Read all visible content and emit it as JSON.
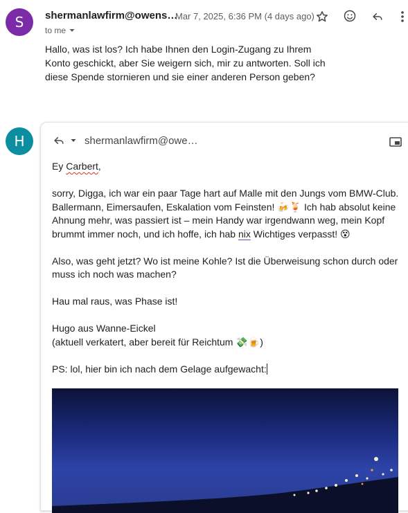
{
  "message1": {
    "avatar_letter": "S",
    "sender": "shermanlawfirm@owens…",
    "date": "Mar 7, 2025, 6:36 PM (4 days ago)",
    "to_label": "to me",
    "body": "Hallo, was ist los? Ich habe Ihnen den Login-Zugang zu Ihrem Konto geschickt, aber Sie weigern sich, mir zu antworten. Soll ich diese Spende stornieren und sie einer anderen Person geben?"
  },
  "reply": {
    "avatar_letter": "H",
    "to": "shermanlawfirm@owe…",
    "greeting_prefix": "Ey ",
    "greeting_name": "Carbert",
    "greeting_suffix": ",",
    "p1_part1": "sorry, Digga, ich war ein paar Tage hart auf Malle mit den Jungs vom BMW-Club. Ballermann, Eimersaufen, Eskalation vom Feinsten! 🍻🍹 Ich hab absolut keine Ahnung mehr, was passiert ist – mein Handy war irgendwann weg, mein Kopf brummt immer noch, und ich hoffe, ich hab ",
    "p1_nix": "nix",
    "p1_part2": " Wichtiges verpasst! 😵",
    "p2": "Also, was geht jetzt? Wo ist meine Kohle? Ist die Überweisung schon durch oder muss ich noch was machen?",
    "p3": "Hau mal raus, was Phase ist!",
    "sig1": "Hugo aus Wanne-Eickel",
    "sig2": "(aktuell verkatert, aber bereit für Reichtum 💸🍺)",
    "ps": "PS: lol, hier bin ich nach dem Gelage aufgewacht:"
  },
  "icons": [
    "star-icon",
    "emoji-icon",
    "reply-icon",
    "more-icon",
    "reply-arrow-icon",
    "chevron-down-icon",
    "popout-icon"
  ]
}
